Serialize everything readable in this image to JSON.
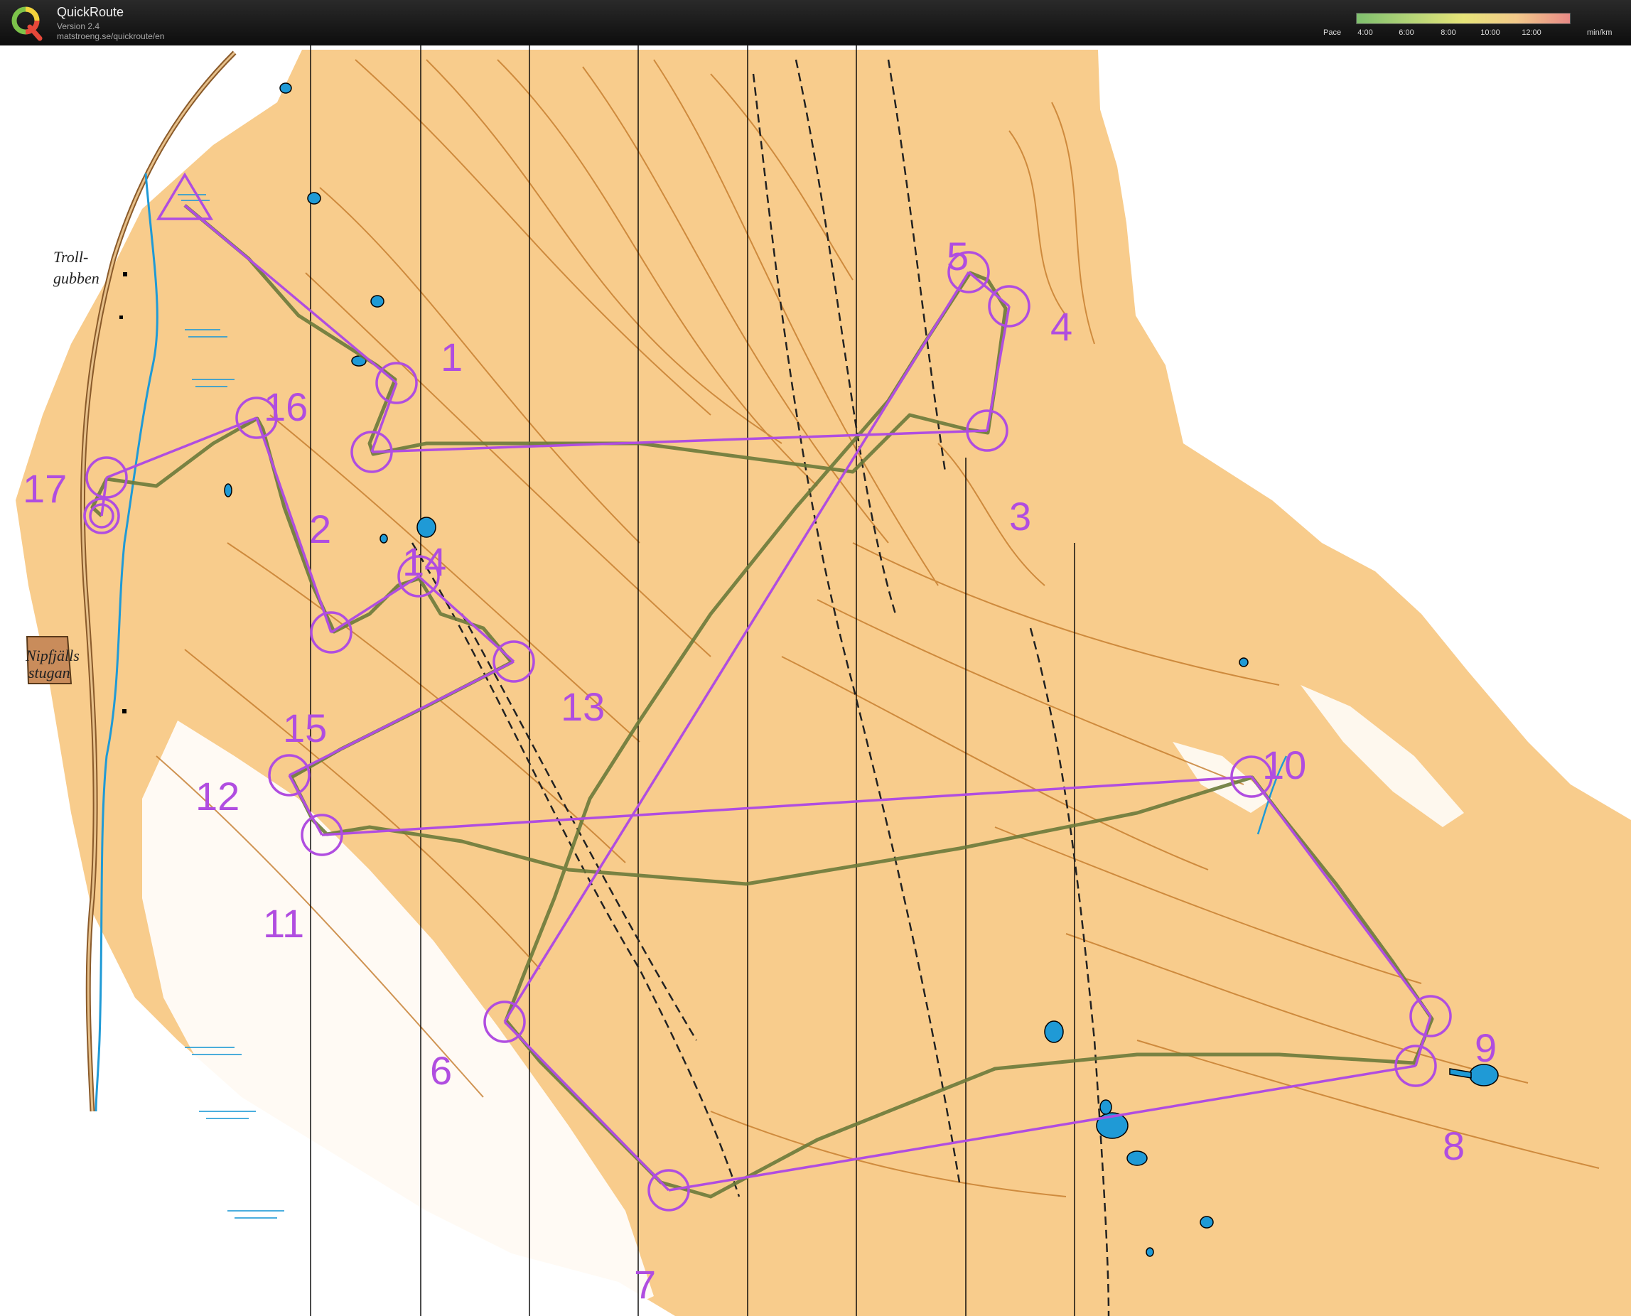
{
  "app": {
    "title": "QuickRoute",
    "version": "Version 2.4",
    "url": "matstroeng.se/quickroute/en"
  },
  "pace_legend": {
    "label": "Pace",
    "ticks": [
      "4:00",
      "6:00",
      "8:00",
      "10:00",
      "12:00"
    ],
    "unit": "min/km"
  },
  "places": {
    "trollgubben_line1": "Troll-",
    "trollgubben_line2": "gubben",
    "nipfjall_line1": "Nipfjälls",
    "nipfjall_line2": "stugan"
  },
  "controls": [
    "1",
    "2",
    "3",
    "4",
    "5",
    "6",
    "7",
    "8",
    "9",
    "10",
    "11",
    "12",
    "13",
    "14",
    "15",
    "16",
    "17"
  ],
  "colors": {
    "course": "#b04de0",
    "route": "#6a7a3a",
    "terrain": "#f8cc8c",
    "contour": "#c47a2a",
    "water": "#1f9ad6",
    "header": "#111111"
  }
}
